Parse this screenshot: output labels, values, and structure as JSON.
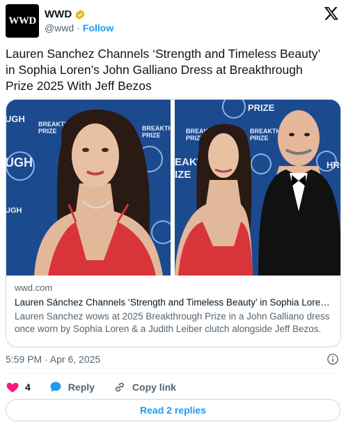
{
  "account": {
    "avatar_text": "WWD",
    "display_name": "WWD",
    "handle": "@wwd",
    "separator": "·",
    "follow_label": "Follow"
  },
  "tweet": {
    "text": "Lauren Sanchez Channels ‘Strength and Timeless Beauty’ in Sophia Loren’s John Galliano Dress at Breakthrough Prize 2025 With Jeff Bezos"
  },
  "card": {
    "domain": "wwd.com",
    "title": "Lauren Sánchez Channels ‘Strength and Timeless Beauty’ in Sophia Lore…",
    "description": "Lauren Sanchez wows at 2025 Breakthrough Prize in a John Galliano dress once worn by Sophia Loren & a Judith Leiber clutch alongside Jeff Bezos.",
    "backdrop_left": [
      "UGH",
      "BREAKTH",
      "PRIZE",
      "UGH",
      "BREAKTH",
      "PRIZE",
      "UGH"
    ],
    "backdrop_right": [
      "PRIZE",
      "BREAK",
      "PRIZE",
      "BREAKTH",
      "PRIZE",
      "EAKT",
      "IZE",
      "HRO"
    ]
  },
  "meta": {
    "timestamp": "5:59 PM · Apr 6, 2025"
  },
  "actions": {
    "like_count": "4",
    "reply_label": "Reply",
    "copy_link_label": "Copy link"
  },
  "footer": {
    "read_replies_label": "Read 2 replies"
  },
  "colors": {
    "accent": "#1d9bf0",
    "like": "#f91880",
    "muted_text": "#536471",
    "backdrop": "#1c4a8f",
    "dress": "#d8343a"
  }
}
